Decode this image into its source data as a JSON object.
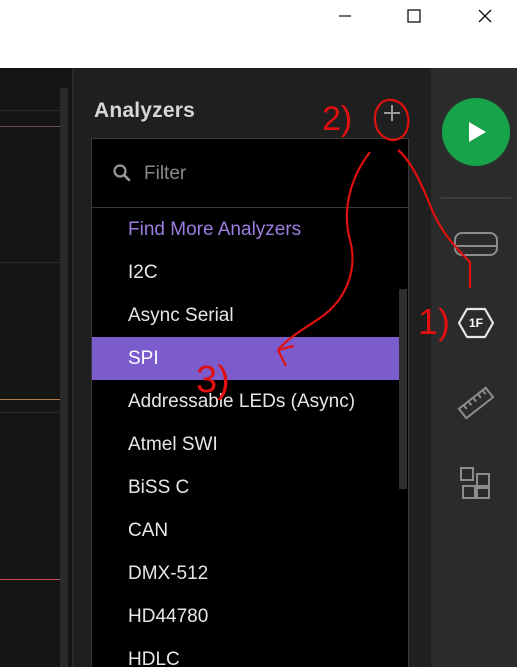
{
  "window": {
    "minimize_icon": "minimize-icon",
    "maximize_icon": "maximize-icon",
    "close_icon": "close-icon"
  },
  "analyzers_panel": {
    "title": "Analyzers",
    "add_icon": "plus-icon",
    "filter": {
      "placeholder": "Filter",
      "value": ""
    },
    "items": [
      {
        "label": "Find More Analyzers",
        "kind": "link"
      },
      {
        "label": "I2C"
      },
      {
        "label": "Async Serial"
      },
      {
        "label": "SPI",
        "selected": true
      },
      {
        "label": "Addressable LEDs (Async)"
      },
      {
        "label": "Atmel SWI"
      },
      {
        "label": "BiSS C"
      },
      {
        "label": "CAN"
      },
      {
        "label": "DMX-512"
      },
      {
        "label": "HD44780"
      },
      {
        "label": "HDLC"
      }
    ]
  },
  "right_sidebar": {
    "run_icon": "play-icon",
    "device_icon": "device-icon",
    "analyzers_icon_label": "1F",
    "measure_icon": "ruler-icon",
    "extensions_icon": "extensions-icon"
  },
  "annotations": {
    "step1": "1)",
    "step2": "2)",
    "step3": "3)"
  },
  "colors": {
    "accent": "#7c5ccc",
    "link": "#9b7ee0",
    "run_green": "#16a34a",
    "annotation_red": "#e01010"
  }
}
